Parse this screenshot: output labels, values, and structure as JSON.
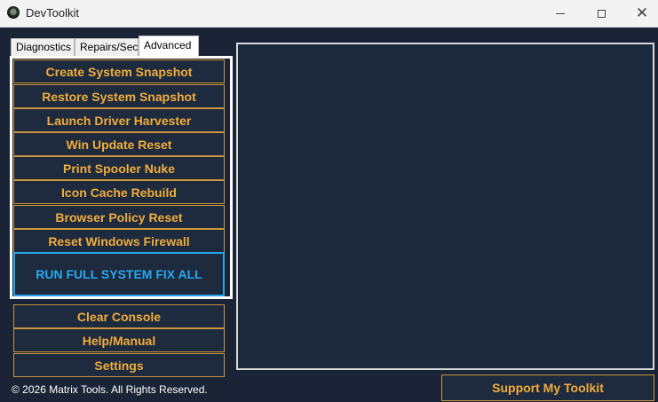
{
  "window": {
    "title": "DevToolkit",
    "controls": {
      "minimize": "minimize-icon",
      "maximize": "maximize-icon",
      "close": "close-icon",
      "close_glyph": "✕"
    }
  },
  "tabs": [
    {
      "label": "Diagnostics",
      "active": false
    },
    {
      "label": "Repairs/Sec",
      "active": false
    },
    {
      "label": "Advanced",
      "active": true
    }
  ],
  "advanced_panel": {
    "buttons": [
      "Create System Snapshot",
      "Restore System Snapshot",
      "Launch Driver Harvester",
      "Win Update Reset",
      "Print Spooler Nuke",
      "Icon Cache Rebuild",
      "Browser Policy Reset",
      "Reset Windows Firewall"
    ],
    "primary_button": "RUN FULL SYSTEM FIX ALL"
  },
  "utility_buttons": [
    "Clear Console",
    "Help/Manual",
    "Settings"
  ],
  "footer": {
    "copyright": "© 2026 Matrix Tools. All Rights Reserved.",
    "support_button": "Support My Toolkit"
  },
  "colors": {
    "background": "#1a2436",
    "accent_gold": "#f0ad3a",
    "accent_blue": "#27a8ee",
    "border_gold": "#c8963c"
  }
}
